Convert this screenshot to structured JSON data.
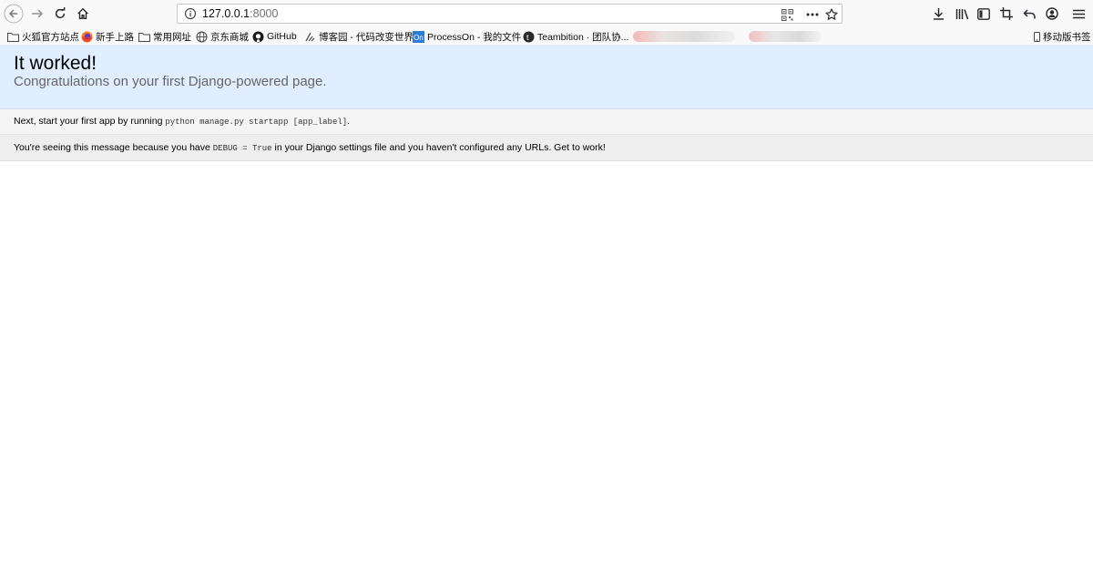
{
  "browser": {
    "url_host": "127.0.0.1",
    "url_port": ":8000",
    "icons": [
      "back-arrow-icon",
      "forward-arrow-icon",
      "reload-icon",
      "home-icon",
      "site-info-icon",
      "qr-code-icon",
      "more-actions-icon",
      "bookmark-star-icon",
      "download-icon",
      "library-icon",
      "sidebar-icon",
      "screenshot-crop-icon",
      "undo-close-tab-icon",
      "account-icon",
      "menu-icon"
    ]
  },
  "bookmarks": {
    "items": [
      {
        "label": "火狐官方站点",
        "icon": "folder-icon"
      },
      {
        "label": "新手上路",
        "icon": "firefox-icon"
      },
      {
        "label": "常用网址",
        "icon": "folder-icon"
      },
      {
        "label": "京东商城",
        "icon": "globe-icon"
      },
      {
        "label": "GitHub",
        "icon": "github-icon"
      },
      {
        "label": "博客园 - 代码改变世界",
        "icon": "cnblogs-icon"
      },
      {
        "label": "ProcessOn - 我的文件",
        "icon": "processon-icon"
      },
      {
        "label": "Teambition · 团队协...",
        "icon": "teambition-icon"
      }
    ],
    "mobile_label": "移动版书签"
  },
  "page": {
    "title": "It worked!",
    "subtitle": "Congratulations on your first Django-powered page.",
    "instructions": {
      "prefix": "Next, start your first app by running ",
      "code": "python manage.py startapp [app_label]",
      "suffix": "."
    },
    "explanation": {
      "prefix": "You're seeing this message because you have ",
      "code": "DEBUG = True",
      "suffix": " in your Django settings file and you haven't configured any URLs. Get to work!"
    }
  },
  "colors": {
    "summary_bg": "#e1eeff",
    "instructions_bg": "#f5f5f5",
    "explanation_bg": "#eeeeee"
  }
}
